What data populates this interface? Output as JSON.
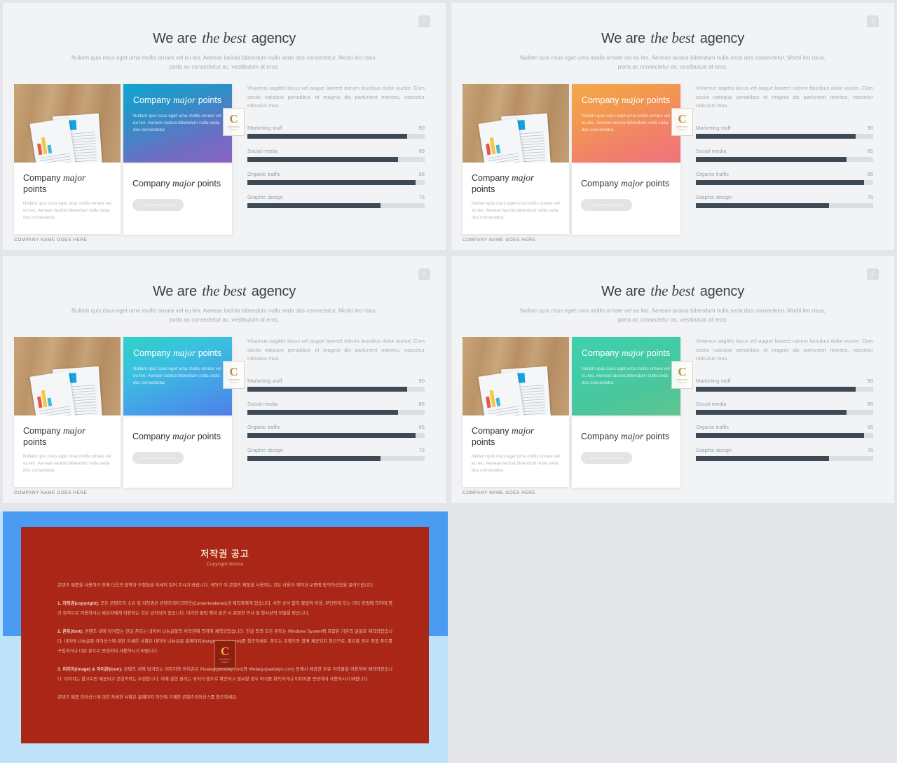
{
  "slides": [
    {
      "number": "2",
      "headline": {
        "pre": "We are ",
        "em": "the best",
        "post": " agency"
      },
      "subline": "Nullam quis risus eget urna mollis ornare vel eu leo. Aenean lacinia bibendum nulla seda dos consectetur. Morbi leo risus, porta ac consectetur ac, vestibulum at eros.",
      "gradient": "linear-gradient(160deg, #12a5cf 0%, #2f8fc6 35%, #6c6ec4 72%, #8a62c0 100%)",
      "card_left": {
        "title_pre": "Company ",
        "title_em": "major",
        "title_post": " points",
        "body": "Nullam quis risus eget urna mollis ornare vel eu leo. Aenean lacinia bibendum nulla seda dos consectetur."
      },
      "card_gradient": {
        "title_pre": "Company ",
        "title_em": "major",
        "title_post": " points",
        "body": "Nullam quis risus eget urna mollis ornare vel eu leo. Aenean lacinia bibendum nulla seda dos consectetur."
      },
      "card_mid": {
        "title_pre": "Company ",
        "title_em": "major",
        "title_post": " points",
        "button": "VIEW MORE INFO"
      },
      "paragraph": "Vivamus sagittis lacus vel augue laoreet rutrum faucibus dolor auctor. Cum sociis natoque penatibus et magnis dis parturient montes, nascetur ridiculus mus.",
      "skills": [
        {
          "label": "Marketing stuff",
          "value": "90"
        },
        {
          "label": "Social media",
          "value": "85"
        },
        {
          "label": "Organic traffic",
          "value": "95"
        },
        {
          "label": "Graphic design",
          "value": "75"
        }
      ],
      "footer": "COMPANY NAME GOES HERE"
    },
    {
      "number": "3",
      "headline": {
        "pre": "We are ",
        "em": "the best",
        "post": " agency"
      },
      "subline": "Nullam quis risus eget urna mollis ornare vel eu leo. Aenean lacinia bibendum nulla seda dos consectetur. Morbi leo risus, porta ac consectetur ac, vestibulum at eros.",
      "gradient": "linear-gradient(160deg, #f4a84b 0%, #f2994f 32%, #f18168 68%, #f1737e 100%)",
      "card_left": {
        "title_pre": "Company ",
        "title_em": "major",
        "title_post": " points",
        "body": "Nullam quis risus eget urna mollis ornare vel eu leo. Aenean lacinia bibendum nulla seda dos consectetur."
      },
      "card_gradient": {
        "title_pre": "Company ",
        "title_em": "major",
        "title_post": " points",
        "body": "Nullam quis risus eget urna mollis ornare vel eu leo. Aenean lacinia bibendum nulla seda dos consectetur."
      },
      "card_mid": {
        "title_pre": "Company ",
        "title_em": "major",
        "title_post": " points",
        "button": "VIEW MORE INFO"
      },
      "paragraph": "Vivamus sagittis lacus vel augue laoreet rutrum faucibus dolor auctor. Cum sociis natoque penatibus et magnis dis parturient montes, nascetur ridiculus mus.",
      "skills": [
        {
          "label": "Marketing stuff",
          "value": "90"
        },
        {
          "label": "Social media",
          "value": "85"
        },
        {
          "label": "Organic traffic",
          "value": "95"
        },
        {
          "label": "Graphic design",
          "value": "75"
        }
      ],
      "footer": "COMPANY NAME GOES HERE"
    },
    {
      "number": "4",
      "headline": {
        "pre": "We are ",
        "em": "the best",
        "post": " agency"
      },
      "subline": "Nullam quis risus eget urna mollis ornare vel eu leo. Aenean lacinia bibendum nulla seda dos consectetur. Morbi leo risus, porta ac consectetur ac, vestibulum at eros.",
      "gradient": "linear-gradient(160deg, #2fd1c7 0%, #3bbfe0 35%, #459ce8 72%, #4f7ee8 100%)",
      "card_left": {
        "title_pre": "Company ",
        "title_em": "major",
        "title_post": " points",
        "body": "Nullam quis risus eget urna mollis ornare vel eu leo. Aenean lacinia bibendum nulla seda dos consectetur."
      },
      "card_gradient": {
        "title_pre": "Company ",
        "title_em": "major",
        "title_post": " points",
        "body": "Nullam quis risus eget urna mollis ornare vel eu leo. Aenean lacinia bibendum nulla seda dos consectetur."
      },
      "card_mid": {
        "title_pre": "Company ",
        "title_em": "major",
        "title_post": " points",
        "button": "VIEW MORE INFO"
      },
      "paragraph": "Vivamus sagittis lacus vel augue laoreet rutrum faucibus dolor auctor. Cum sociis natoque penatibus et magnis dis parturient montes, nascetur ridiculus mus.",
      "skills": [
        {
          "label": "Marketing stuff",
          "value": "90"
        },
        {
          "label": "Social media",
          "value": "85"
        },
        {
          "label": "Organic traffic",
          "value": "95"
        },
        {
          "label": "Graphic design",
          "value": "75"
        }
      ],
      "footer": "COMPANY NAME GOES HERE"
    },
    {
      "number": "5",
      "headline": {
        "pre": "We are ",
        "em": "the best",
        "post": " agency"
      },
      "subline": "Nullam quis risus eget urna mollis ornare vel eu leo. Aenean lacinia bibendum nulla seda dos consectetur. Morbi leo risus, porta ac consectetur ac, vestibulum at eros.",
      "gradient": "linear-gradient(160deg, #3fd0ae 0%, #42cba6 35%, #4cc69b 70%, #63c48f 100%)",
      "card_left": {
        "title_pre": "Company ",
        "title_em": "major",
        "title_post": " points",
        "body": "Nullam quis risus eget urna mollis ornare vel eu leo. Aenean lacinia bibendum nulla seda dos consectetur."
      },
      "card_gradient": {
        "title_pre": "Company ",
        "title_em": "major",
        "title_post": " points",
        "body": "Nullam quis risus eget urna mollis ornare vel eu leo. Aenean lacinia bibendum nulla seda dos consectetur."
      },
      "card_mid": {
        "title_pre": "Company ",
        "title_em": "major",
        "title_post": " points",
        "button": "VIEW MORE INFO"
      },
      "paragraph": "Vivamus sagittis lacus vel augue laoreet rutrum faucibus dolor auctor. Cum sociis natoque penatibus et magnis dis parturient montes, nascetur ridiculus mus.",
      "skills": [
        {
          "label": "Marketing stuff",
          "value": "90"
        },
        {
          "label": "Social media",
          "value": "85"
        },
        {
          "label": "Organic traffic",
          "value": "95"
        },
        {
          "label": "Graphic design",
          "value": "75"
        }
      ],
      "footer": "COMPANY NAME GOES HERE"
    }
  ],
  "watermark": {
    "letter": "C",
    "line1": "CONTENTS",
    "line2": "TAKEOUT"
  },
  "copyright": {
    "title": "저작권 공고",
    "subtitle": "Copyright Notice",
    "intro": "콘텐츠 제품을 사용하기 전에 다음의 협약과 조항들을 자세히 읽어 주시기 바랍니다. 귀하가 이 콘텐츠 제품을 사용하는 것은 사용자 계약과 보증에 동의하셨음을 알려드립니다.",
    "item1_label": "1. 저작권(copyright):",
    "item1": " 모든 콘텐츠의 소유 및 저작권은 콘텐츠테이크아웃(Contentstakeout)과 제작자에게 있습니다. 사전 승낙 없이 불법적 이용, 무단전재 또는 기타 방법에 의하여 영리 목적으로 이용하거나 제삼자에게 이용하는 것은 금지되어 있습니다. 이러한 불법 행위 발견 시 준엄한 민사 및 형사상의 처벌을 받습니다.",
    "item2_label": "2. 폰트(font):",
    "item2": " 콘텐츠 내에 담겨있는 한글 폰트는 네이버 나눔글꼴의 저작권에 의하여 제작되었습니다. 한글 외의 모든 폰트는 Windows System에 포함된 기본의 글꼴로 제작되었습니다. 네이버 나눔글꼴 라이선스에 대한 자세한 사항은 네이버 나눔글꼴 홈페이지(hangeul.naver.com)를 참조하세요. 폰트는 콘텐츠와 함께 제공되지 않으므로, 필요할 경우 정품 폰트를 구입하거나 다른 폰트로 변경하여 사용하시기 바랍니다.",
    "item3_label": "3. 이미지(image) & 아이콘(icon):",
    "item3": " 콘텐츠 내에 담겨있는 이미지와 아이콘은 Pixabay(pixabay.com)와 Webalys(webalys.com) 등에서 제공한 무료 저작물을 이용하여 제작되었습니다. 이미지는 참고로만 제공되고 콘텐츠와는 무관합니다. 이에 관한 권리는 귀하가 별도로 확인하고 필요할 경우 허가를 취득하거나 이미지를 변경하여 사용하시기 바랍니다.",
    "footer": "콘텐츠 제품 라이선스에 대한 자세한 사항은 홈페이지 하단에 기재한 콘텐츠라이선스를 참조하세요."
  }
}
